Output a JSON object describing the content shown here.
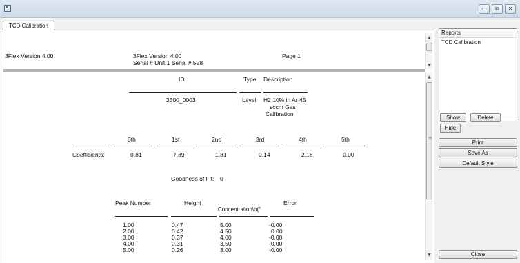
{
  "window": {
    "tab_label": "TCD Calibration"
  },
  "window_buttons": {
    "minimize": "▭",
    "restore": "⧉",
    "close": "✕"
  },
  "report_header": {
    "left_version": "3Flex Version 4.00",
    "center_version": "3Flex Version 4.00",
    "serial": "Serial # Unit 1  Serial # 528",
    "page": "Page 1"
  },
  "id_section": {
    "id_label": "ID",
    "type_label": "Type",
    "description_label": "Description",
    "id_value": "3500_0003",
    "type_value": "Level",
    "description_lines": [
      "H2 10% in Ar 45",
      "sccm Gas",
      "Calibration"
    ]
  },
  "coefficients": {
    "headers": [
      "0th",
      "1st",
      "2nd",
      "3rd",
      "4th",
      "5th"
    ],
    "row_label": "Coefficients:",
    "values": [
      "0.81",
      "7.89",
      "1.81",
      "0.14",
      "2.18",
      "0.00"
    ]
  },
  "goodness": {
    "label": "Goodness of Fit:",
    "value": "0"
  },
  "peak_table": {
    "headers": [
      "Peak Number",
      "Height",
      "Concentration\\b(°",
      "Error"
    ],
    "rows": [
      [
        "1.00",
        "0.47",
        "5.00",
        "-0.00"
      ],
      [
        "2.00",
        "0.42",
        "4.50",
        "0.00"
      ],
      [
        "3.00",
        "0.37",
        "4.00",
        "-0.00"
      ],
      [
        "4.00",
        "0.31",
        "3.50",
        "-0.00"
      ],
      [
        "5.00",
        "0.26",
        "3.00",
        "-0.00"
      ]
    ]
  },
  "side_panel": {
    "reports_header": "Reports",
    "reports_items": [
      "TCD Calibration"
    ],
    "show_label": "Show",
    "delete_label": "Delete",
    "hide_label": "Hide",
    "print_label": "Print",
    "save_as_label": "Save As",
    "default_style_label": "Default Style",
    "close_label": "Close"
  }
}
